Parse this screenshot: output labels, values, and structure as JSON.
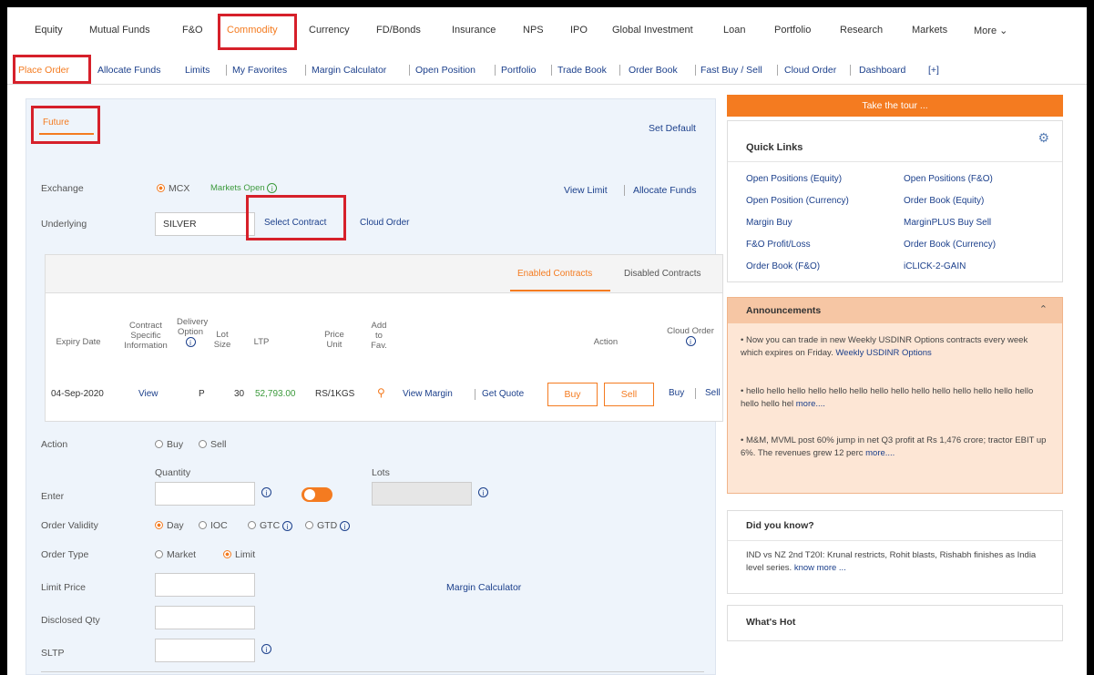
{
  "topnav": [
    "Equity",
    "Mutual Funds",
    "F&O",
    "Commodity",
    "Currency",
    "FD/Bonds",
    "Insurance",
    "NPS",
    "IPO",
    "Global Investment",
    "Loan",
    "Portfolio",
    "Research",
    "Markets",
    "More"
  ],
  "subnav": [
    "Place Order",
    "Allocate Funds",
    "Limits",
    "My Favorites",
    "Margin Calculator",
    "Open Position",
    "Portfolio",
    "Trade Book",
    "Order Book",
    "Fast Buy / Sell",
    "Cloud Order",
    "Dashboard",
    "[+]"
  ],
  "order": {
    "tab": "Future",
    "set_default": "Set Default",
    "exchange_label": "Exchange",
    "exchange_value": "MCX",
    "market_status": "Markets Open",
    "view_limit": "View Limit",
    "allocate_funds": "Allocate Funds",
    "underlying_label": "Underlying",
    "underlying_value": "SILVER",
    "select_contract": "Select Contract",
    "cloud_order": "Cloud Order",
    "enabled_contracts": "Enabled Contracts",
    "disabled_contracts": "Disabled Contracts",
    "headers": {
      "expiry": "Expiry Date",
      "contract_info": "Contract Specific Information",
      "delivery": "Delivery Option",
      "lot": "Lot Size",
      "ltp": "LTP",
      "price_unit": "Price Unit",
      "add_fav": "Add to Fav.",
      "action": "Action",
      "cloud_order": "Cloud Order"
    },
    "row": {
      "expiry": "04-Sep-2020",
      "view": "View",
      "delivery": "P",
      "lot": "30",
      "ltp": "52,793.00",
      "price_unit": "RS/1KGS",
      "view_margin": "View Margin",
      "get_quote": "Get Quote",
      "buy": "Buy",
      "sell": "Sell",
      "cloud_buy": "Buy",
      "cloud_sell": "Sell"
    },
    "action_label": "Action",
    "buy": "Buy",
    "sell": "Sell",
    "quantity": "Quantity",
    "lots": "Lots",
    "enter_label": "Enter",
    "validity_label": "Order Validity",
    "validity": [
      "Day",
      "IOC",
      "GTC",
      "GTD"
    ],
    "type_label": "Order Type",
    "type": [
      "Market",
      "Limit"
    ],
    "limit_price": "Limit Price",
    "margin_calculator": "Margin Calculator",
    "disclosed_qty": "Disclosed Qty",
    "sltp": "SLTP"
  },
  "right": {
    "tour": "Take the tour ...",
    "quick_links_title": "Quick Links",
    "quick_links": [
      "Open Positions (Equity)",
      "Open Positions (F&O)",
      "Open Position (Currency)",
      "Order Book (Equity)",
      "Margin Buy",
      "MarginPLUS Buy Sell",
      "F&O Profit/Loss",
      "Order Book (Currency)",
      "Order Book (F&O)",
      "iCLICK-2-GAIN"
    ],
    "announcements_title": "Announcements",
    "ann1": "Now you can trade in new Weekly USDINR Options contracts every week which expires on Friday.",
    "ann1_link": "Weekly USDINR Options",
    "ann2": "hello hello hello hello hello hello hello hello hello hello hello hello hello hello hello hello hel",
    "ann2_link": "more....",
    "ann3": "M&M, MVML post 60% jump in net Q3 profit at Rs 1,476 crore; tractor EBIT up 6%. The revenues grew 12 perc",
    "ann3_link": "more....",
    "did_you_know_title": "Did you know?",
    "did_you_know": "IND vs NZ 2nd T20I: Krunal restricts, Rohit blasts, Rishabh finishes as India level series.",
    "did_you_know_link": "know more ...",
    "whats_hot": "What's Hot"
  }
}
